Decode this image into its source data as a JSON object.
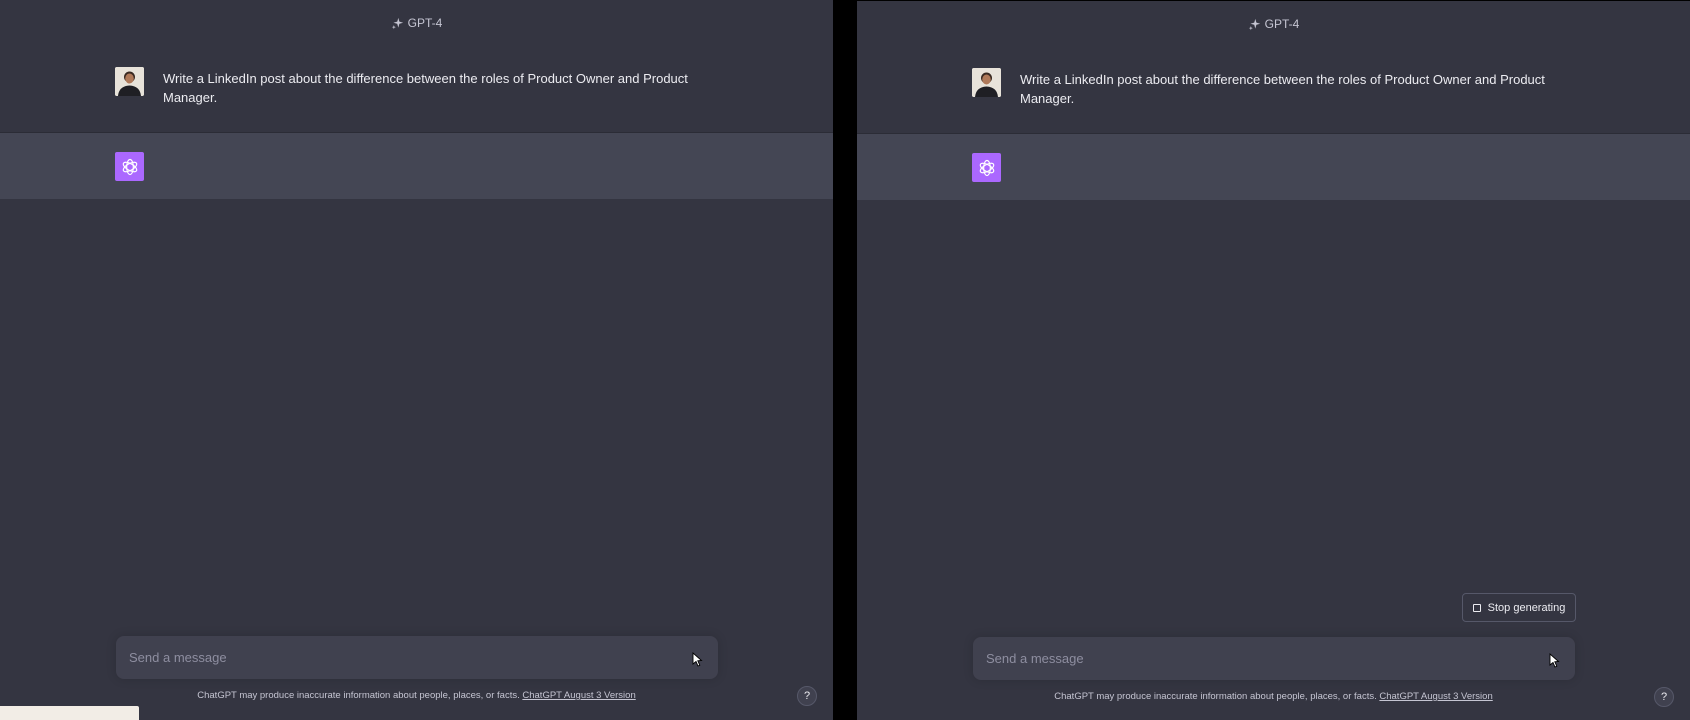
{
  "panels": [
    {
      "model_label": "GPT-4",
      "user_prompt": "Write a LinkedIn post about the difference between the roles of Product Owner and Product Manager.",
      "composer_placeholder": "Send a message",
      "footer_text": "ChatGPT may produce inaccurate information about people, places, or facts.",
      "footer_link": "ChatGPT August 3 Version",
      "help_label": "?"
    },
    {
      "model_label": "GPT-4",
      "user_prompt": "Write a LinkedIn post about the difference between the roles of Product Owner and Product Manager.",
      "stop_label": "Stop generating",
      "composer_placeholder": "Send a message",
      "footer_text": "ChatGPT may produce inaccurate information about people, places, or facts.",
      "footer_link": "ChatGPT August 3 Version",
      "help_label": "?"
    }
  ],
  "colors": {
    "background": "#343541",
    "assistant_row": "#444654",
    "gpt_logo": "#ab68ff",
    "composer": "#40414f"
  },
  "icons": {
    "model": "sparkle-icon",
    "assistant": "openai-logo-icon",
    "stop": "stop-square-icon",
    "pointer": "mouse-cursor-icon",
    "help": "help-icon"
  }
}
